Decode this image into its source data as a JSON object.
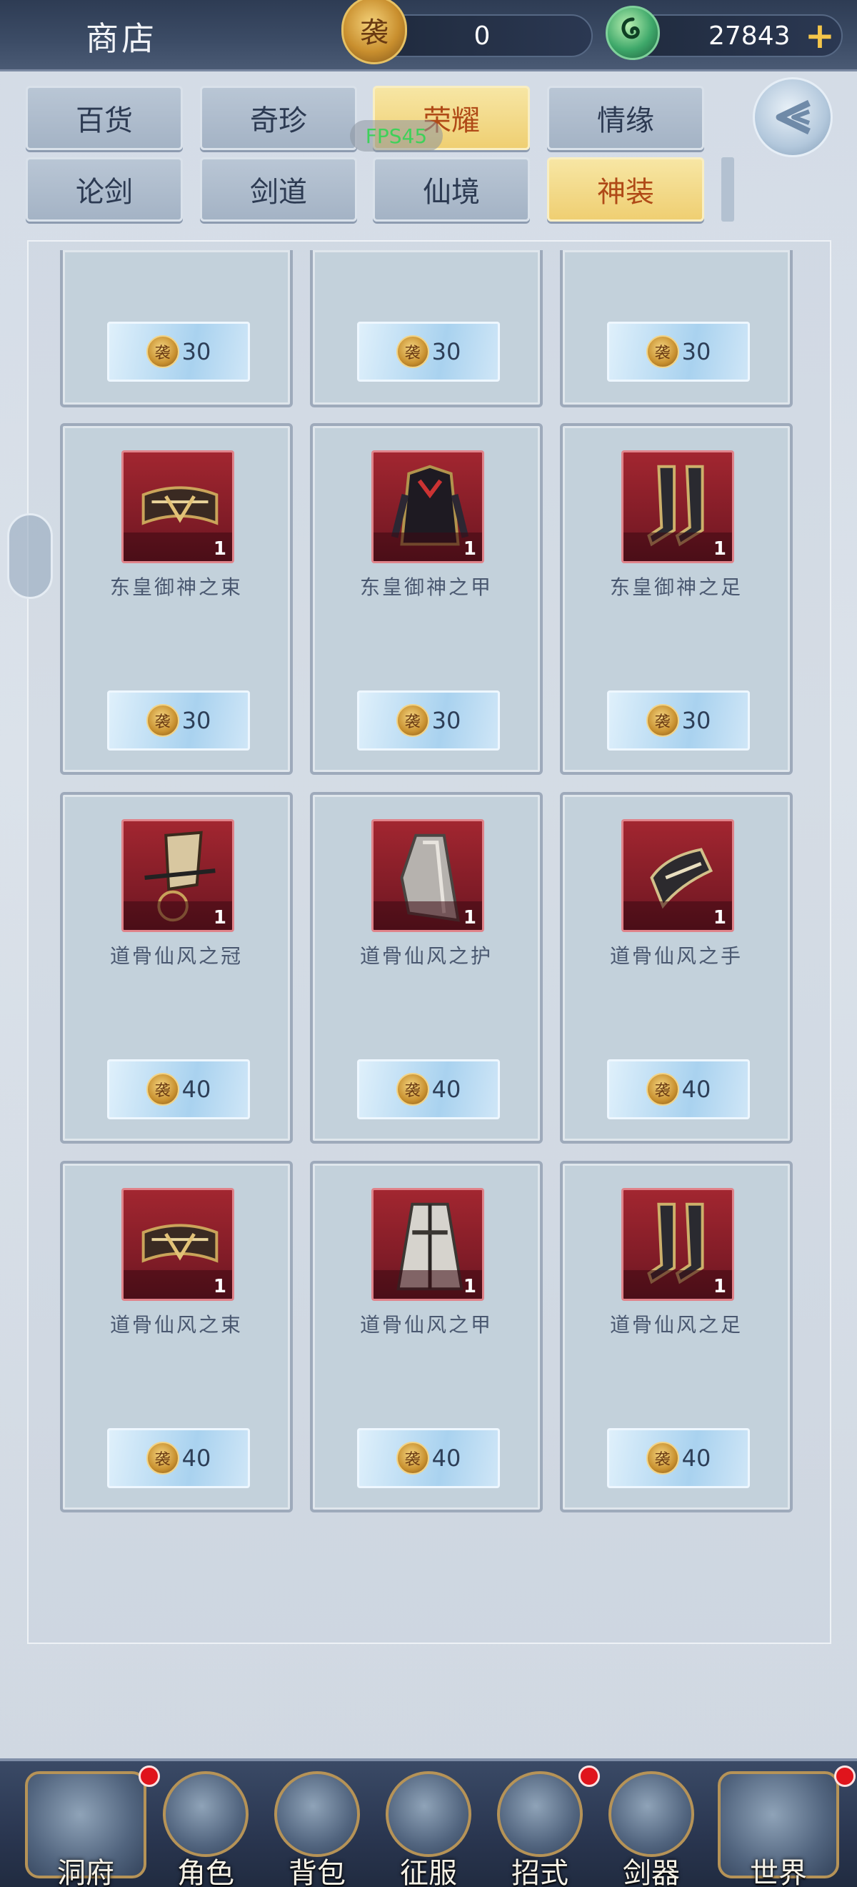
{
  "header": {
    "title": "商店",
    "currency_a_icon_char": "袭",
    "currency_a_value": "0",
    "currency_b_value": "27843",
    "add_label": "+"
  },
  "fps_label": "FPS45",
  "tabs_row1": [
    {
      "label": "百货",
      "active": false
    },
    {
      "label": "奇珍",
      "active": false
    },
    {
      "label": "荣耀",
      "active": true
    },
    {
      "label": "情缘",
      "active": false
    }
  ],
  "tabs_row2": [
    {
      "label": "论剑",
      "active": false
    },
    {
      "label": "剑道",
      "active": false
    },
    {
      "label": "仙境",
      "active": false
    },
    {
      "label": "神装",
      "active": true
    }
  ],
  "coin_char": "袭",
  "partial_row": [
    {
      "price": "30"
    },
    {
      "price": "30"
    },
    {
      "price": "30"
    }
  ],
  "items": [
    {
      "name": "东皇御神之束",
      "qty": "1",
      "price": "30",
      "icon": "belt-icon"
    },
    {
      "name": "东皇御神之甲",
      "qty": "1",
      "price": "30",
      "icon": "armor-icon"
    },
    {
      "name": "东皇御神之足",
      "qty": "1",
      "price": "30",
      "icon": "boots-icon"
    },
    {
      "name": "道骨仙风之冠",
      "qty": "1",
      "price": "40",
      "icon": "crown-icon"
    },
    {
      "name": "道骨仙风之护",
      "qty": "1",
      "price": "40",
      "icon": "cape-icon"
    },
    {
      "name": "道骨仙风之手",
      "qty": "1",
      "price": "40",
      "icon": "gauntlet-icon"
    },
    {
      "name": "道骨仙风之束",
      "qty": "1",
      "price": "40",
      "icon": "belt-icon"
    },
    {
      "name": "道骨仙风之甲",
      "qty": "1",
      "price": "40",
      "icon": "robe-icon"
    },
    {
      "name": "道骨仙风之足",
      "qty": "1",
      "price": "40",
      "icon": "boots-icon"
    }
  ],
  "bottom_nav": [
    {
      "label": "洞府",
      "badge": true
    },
    {
      "label": "角色",
      "badge": false
    },
    {
      "label": "背包",
      "badge": false
    },
    {
      "label": "征服",
      "badge": false
    },
    {
      "label": "招式",
      "badge": true
    },
    {
      "label": "剑器",
      "badge": false
    },
    {
      "label": "世界",
      "badge": true
    }
  ]
}
